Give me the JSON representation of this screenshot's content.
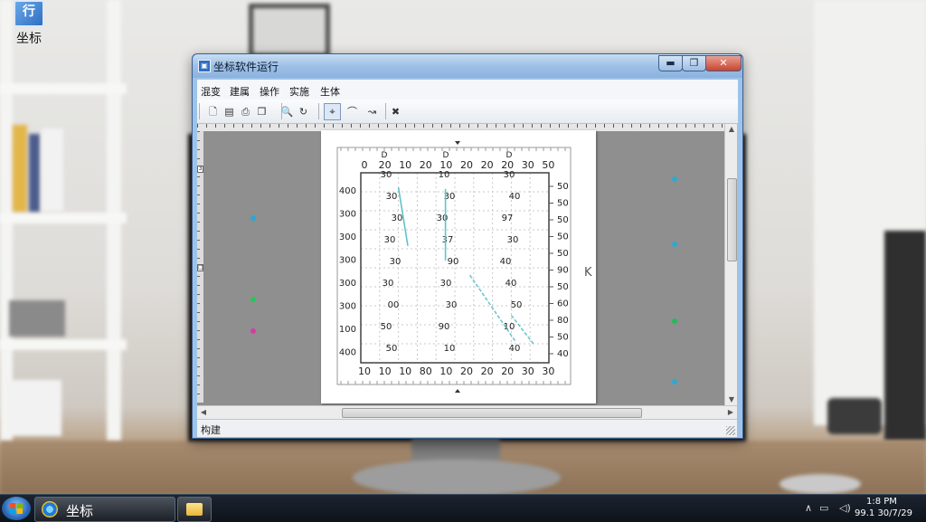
{
  "desktop": {
    "icon_label": "坐标",
    "icon_glyph": "行"
  },
  "window": {
    "title": "坐标软件运行",
    "controls": {
      "minimize": "▬",
      "maximize": "❐",
      "close": "✕"
    }
  },
  "menu": [
    "混变",
    "建属",
    "操作",
    "实施",
    "生体"
  ],
  "toolbar": {
    "tools": [
      {
        "name": "new-doc-icon",
        "glyph": "🗋"
      },
      {
        "name": "open-icon",
        "glyph": "▤"
      },
      {
        "name": "print-icon",
        "glyph": "⎙"
      },
      {
        "name": "copy-icon",
        "glyph": "❐"
      },
      {
        "name": "zoom-icon",
        "glyph": "🔍"
      },
      {
        "name": "refresh-icon",
        "glyph": "↻"
      },
      {
        "name": "pick-tool-icon",
        "glyph": "⌖"
      },
      {
        "name": "curve-tool-icon",
        "glyph": "⌒"
      },
      {
        "name": "line-tool-icon",
        "glyph": "↝"
      },
      {
        "name": "tools-icon",
        "glyph": "✖"
      }
    ]
  },
  "status": {
    "text": "构建"
  },
  "ruler": {
    "left_marks": [
      "3",
      "□"
    ]
  },
  "page": {
    "side_mark": "K"
  },
  "chart_data": {
    "type": "scatter",
    "top_ticks": [
      "0",
      "20",
      "10",
      "20",
      "10",
      "20",
      "20",
      "20",
      "30",
      "50"
    ],
    "top_small_labels": [
      "D",
      "D",
      "D"
    ],
    "bottom_ticks": [
      "10",
      "10",
      "10",
      "80",
      "10",
      "20",
      "20",
      "20",
      "30",
      "30"
    ],
    "left_ticks": [
      "400",
      "300",
      "300",
      "300",
      "300",
      "300",
      "100",
      "400"
    ],
    "right_ticks": [
      "50",
      "50",
      "50",
      "50",
      "50",
      "90",
      "50",
      "60",
      "80",
      "50",
      "40"
    ],
    "inner_labels": [
      "30",
      "10",
      "30",
      "30",
      "30",
      "40",
      "30",
      "30",
      "97",
      "30",
      "37",
      "30",
      "30",
      "90",
      "40",
      "30",
      "30",
      "40",
      "00",
      "30",
      "50",
      "50",
      "90",
      "10",
      "50",
      "10",
      "40",
      "400"
    ],
    "series": [
      {
        "color": "#5fc4c8",
        "points": [
          [
            20,
            180
          ],
          [
            25,
            260
          ]
        ]
      },
      {
        "color": "#5fc4c8",
        "points": [
          [
            45,
            182
          ],
          [
            45,
            280
          ]
        ]
      },
      {
        "color": "#6fc7cf",
        "points": [
          [
            58,
            300
          ],
          [
            82,
            390
          ]
        ]
      },
      {
        "color": "#6fc7cf",
        "points": [
          [
            80,
            355
          ],
          [
            92,
            395
          ]
        ]
      }
    ],
    "xlim": [
      0,
      100
    ],
    "ylim": [
      160,
      420
    ],
    "grid": true
  },
  "markers": [
    {
      "color": "#2aa7d6"
    },
    {
      "color": "#27c65a"
    },
    {
      "color": "#d83aa5"
    },
    {
      "color": "#2fa9cf"
    },
    {
      "color": "#2fa9cf"
    },
    {
      "color": "#27b85a"
    },
    {
      "color": "#2fa9cf"
    }
  ],
  "taskbar": {
    "task_label": "坐标"
  },
  "tray": {
    "clock_time": "1:8 PM",
    "clock_date": "99.1 30/7/29"
  },
  "colors": {
    "accent": "#2f6fc2",
    "series": "#5fc4c8"
  }
}
